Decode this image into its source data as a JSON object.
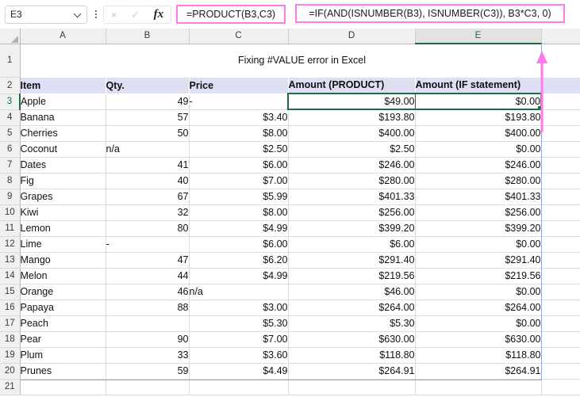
{
  "app": "Microsoft Excel",
  "formula_bar": {
    "name_box_value": "E3",
    "name_box_icon": "chevron-down-icon",
    "more_icon": "kebab-menu-icon",
    "cancel_icon": "×",
    "enter_icon": "✓",
    "fx_icon": "fx",
    "formula_d": "=PRODUCT(B3,C3)",
    "formula_e": "=IF(AND(ISNUMBER(B3), ISNUMBER(C3)), B3*C3, 0)",
    "highlight_color": "#ff7ae8"
  },
  "sheet": {
    "columns": [
      "A",
      "B",
      "C",
      "D",
      "E"
    ],
    "selected_column": "E",
    "selected_cell": "E3",
    "selected_range_label": "D3:E3",
    "row_numbers": [
      "1",
      "2",
      "3",
      "4",
      "5",
      "6",
      "7",
      "8",
      "9",
      "10",
      "11",
      "12",
      "13",
      "14",
      "15",
      "16",
      "17",
      "18",
      "19",
      "20",
      "21"
    ],
    "title": "Fixing #VALUE error in Excel",
    "header_bg": "#dce0f2",
    "accent_green": "#1d6b3e",
    "headers": {
      "item": "Item",
      "qty": "Qty.",
      "price": "Price",
      "amount_product": "Amount (PRODUCT)",
      "amount_if": "Amount (IF statement)"
    },
    "rows": [
      {
        "n": "3",
        "item": "Apple",
        "qty": "49",
        "price": "-",
        "amount_product": "$49.00",
        "amount_if": "$0.00"
      },
      {
        "n": "4",
        "item": "Banana",
        "qty": "57",
        "price": "$3.40",
        "amount_product": "$193.80",
        "amount_if": "$193.80"
      },
      {
        "n": "5",
        "item": "Cherries",
        "qty": "50",
        "price": "$8.00",
        "amount_product": "$400.00",
        "amount_if": "$400.00"
      },
      {
        "n": "6",
        "item": "Coconut",
        "qty": "n/a",
        "price": "$2.50",
        "amount_product": "$2.50",
        "amount_if": "$0.00"
      },
      {
        "n": "7",
        "item": "Dates",
        "qty": "41",
        "price": "$6.00",
        "amount_product": "$246.00",
        "amount_if": "$246.00"
      },
      {
        "n": "8",
        "item": "Fig",
        "qty": "40",
        "price": "$7.00",
        "amount_product": "$280.00",
        "amount_if": "$280.00"
      },
      {
        "n": "9",
        "item": "Grapes",
        "qty": "67",
        "price": "$5.99",
        "amount_product": "$401.33",
        "amount_if": "$401.33"
      },
      {
        "n": "10",
        "item": "Kiwi",
        "qty": "32",
        "price": "$8.00",
        "amount_product": "$256.00",
        "amount_if": "$256.00"
      },
      {
        "n": "11",
        "item": "Lemon",
        "qty": "80",
        "price": "$4.99",
        "amount_product": "$399.20",
        "amount_if": "$399.20"
      },
      {
        "n": "12",
        "item": "Lime",
        "qty": "-",
        "price": "$6.00",
        "amount_product": "$6.00",
        "amount_if": "$0.00"
      },
      {
        "n": "13",
        "item": "Mango",
        "qty": "47",
        "price": "$6.20",
        "amount_product": "$291.40",
        "amount_if": "$291.40"
      },
      {
        "n": "14",
        "item": "Melon",
        "qty": "44",
        "price": "$4.99",
        "amount_product": "$219.56",
        "amount_if": "$219.56"
      },
      {
        "n": "15",
        "item": "Orange",
        "qty": "46",
        "price": "n/a",
        "amount_product": "$46.00",
        "amount_if": "$0.00"
      },
      {
        "n": "16",
        "item": "Papaya",
        "qty": "88",
        "price": "$3.00",
        "amount_product": "$264.00",
        "amount_if": "$264.00"
      },
      {
        "n": "17",
        "item": "Peach",
        "qty": "",
        "price": "$5.30",
        "amount_product": "$5.30",
        "amount_if": "$0.00"
      },
      {
        "n": "18",
        "item": "Pear",
        "qty": "90",
        "price": "$7.00",
        "amount_product": "$630.00",
        "amount_if": "$630.00"
      },
      {
        "n": "19",
        "item": "Plum",
        "qty": "33",
        "price": "$3.60",
        "amount_product": "$118.80",
        "amount_if": "$118.80"
      },
      {
        "n": "20",
        "item": "Prunes",
        "qty": "59",
        "price": "$4.49",
        "amount_product": "$264.91",
        "amount_if": "$264.91"
      },
      {
        "n": "21",
        "item": "",
        "qty": "",
        "price": "",
        "amount_product": "",
        "amount_if": ""
      }
    ]
  },
  "annotation": {
    "arrow_color": "#ff7ae8",
    "arrow_name": "callout-arrow-to-formula"
  }
}
